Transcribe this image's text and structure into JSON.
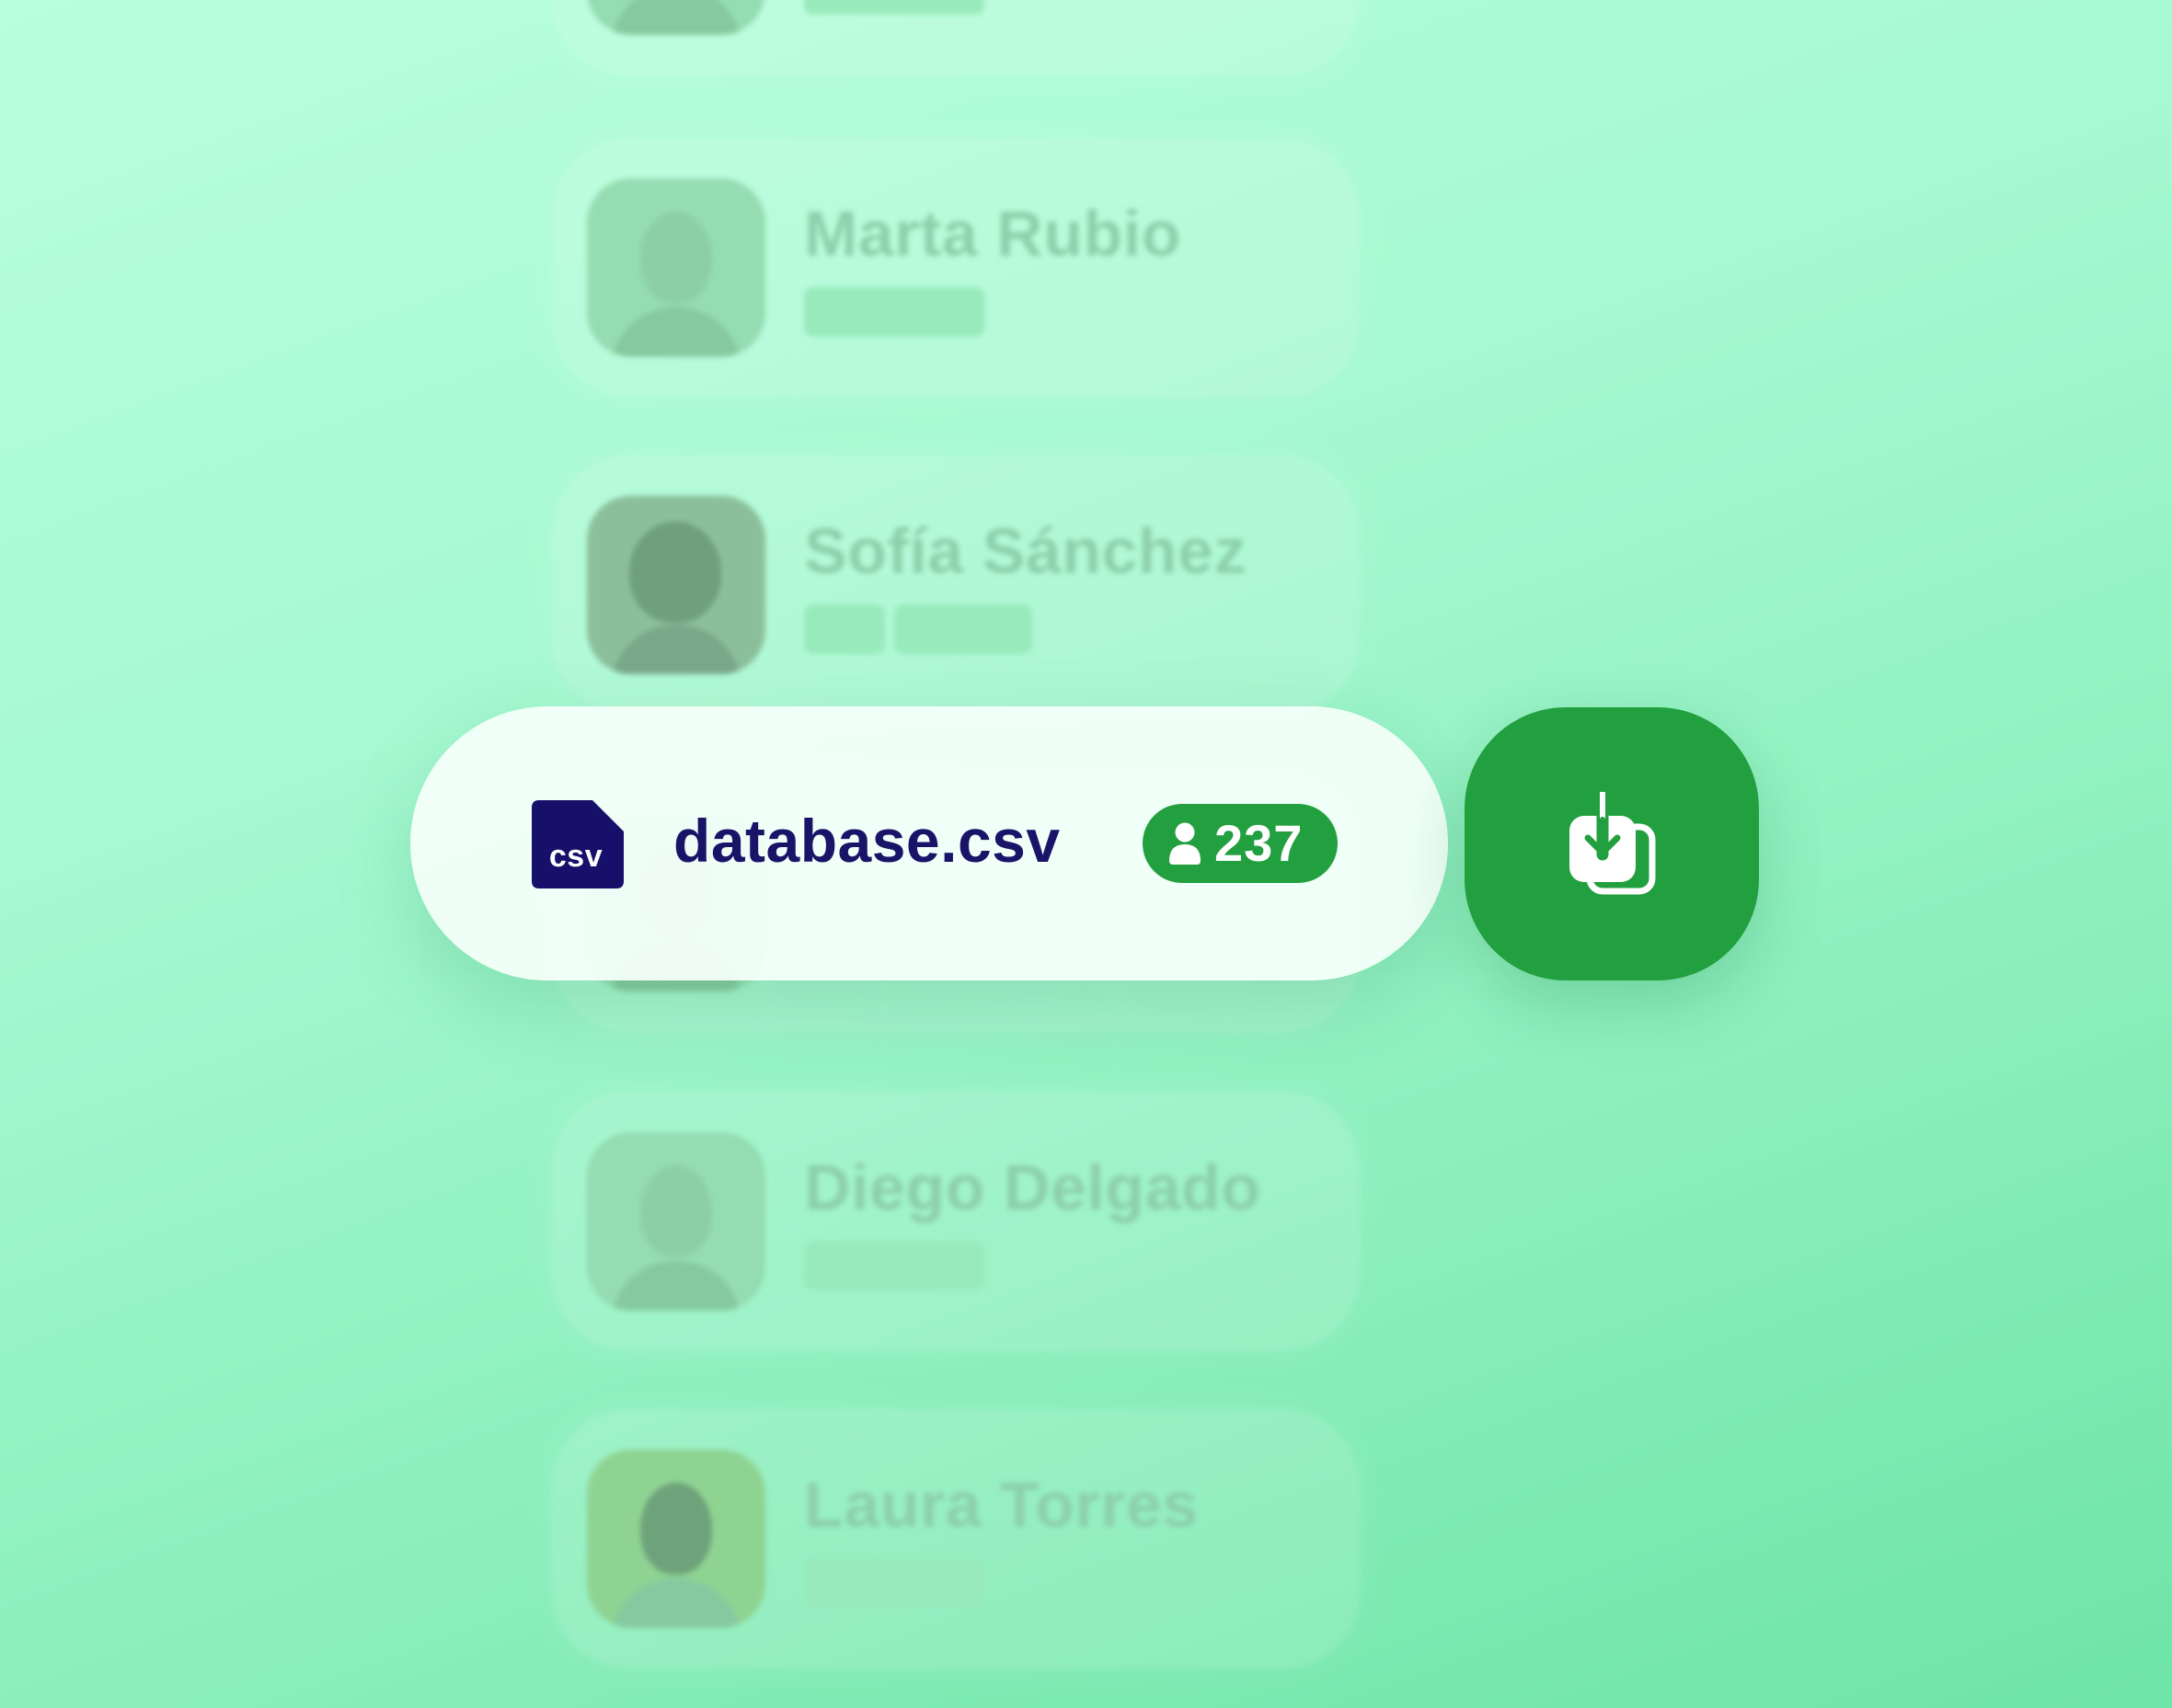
{
  "people": [
    {
      "name": "",
      "tags": [
        ""
      ]
    },
    {
      "name": "Marta Rubio",
      "tags": [
        ""
      ]
    },
    {
      "name": "Sofía Sánchez",
      "tags": [
        "",
        ""
      ]
    },
    {
      "name": "",
      "tags": []
    },
    {
      "name": "Diego Delgado",
      "tags": [
        ""
      ]
    },
    {
      "name": "Laura Torres",
      "tags": [
        ""
      ]
    }
  ],
  "file": {
    "icon_label": "csv",
    "name": "database.csv",
    "contact_count": "237",
    "icon": "csv-file-icon",
    "count_icon": "user-icon"
  },
  "download_button": {
    "icon": "download-icon"
  },
  "colors": {
    "accent_green": "#22a03f",
    "file_name_navy": "#1a1468",
    "csv_icon_navy": "#16106a",
    "background_top": "#b8ffdc",
    "background_bottom": "#6ee4a6"
  }
}
